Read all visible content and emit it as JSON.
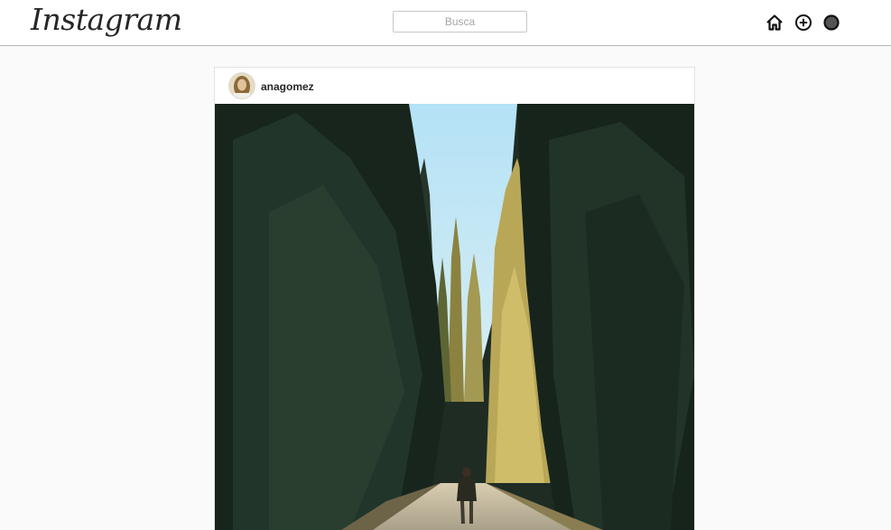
{
  "app": {
    "logo_text": "Instagram"
  },
  "header": {
    "search": {
      "placeholder": "Busca",
      "value": ""
    },
    "nav_icons": [
      "home-icon",
      "add-icon",
      "profile-icon"
    ]
  },
  "post": {
    "username": "anagomez",
    "image_alt": "Avenue of tall cypress trees with a person walking on a path"
  },
  "colors": {
    "background": "#fafafa",
    "topbar": "#ffffff",
    "text": "#262626",
    "sky": "#a9dcf2",
    "trees_dark": "#1b2b22",
    "trees_lit": "#b8a85a"
  }
}
